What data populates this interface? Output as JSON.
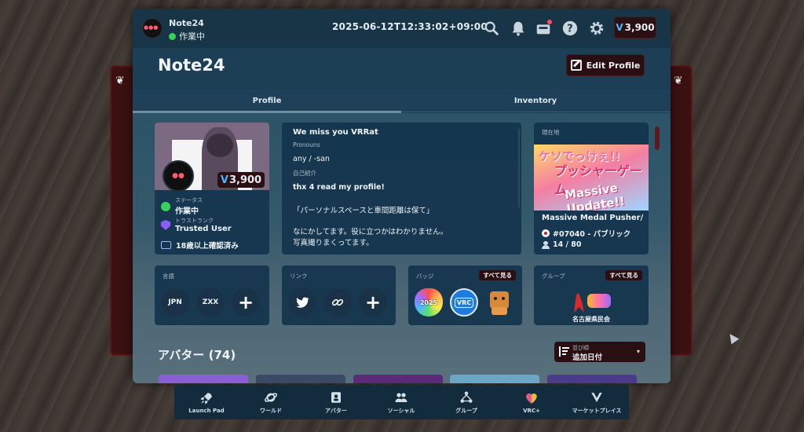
{
  "header": {
    "user_name": "Note24",
    "status": "作業中",
    "timestamp": "2025-06-12T12:33:02+09:00",
    "currency_symbol": "V",
    "currency_amount": "3,900",
    "icons": [
      "search-icon",
      "bell-icon",
      "mailbox-icon",
      "help-icon",
      "gear-icon"
    ]
  },
  "page": {
    "title": "Note24",
    "edit_profile": "Edit Profile"
  },
  "tabs": [
    {
      "label": "Profile",
      "active": true
    },
    {
      "label": "Inventory",
      "active": false
    }
  ],
  "profile_card": {
    "balance": "3,900",
    "status_label": "ステータス",
    "status_value": "作業中",
    "trust_label": "トラストランク",
    "trust_value": "Trusted User",
    "age_verified": "18歳以上確認済み"
  },
  "bio": {
    "title": "We miss you VRRat",
    "pronouns_label": "Pronouns",
    "pronouns": "any / -san",
    "intro_label": "自己紹介",
    "lines": [
      "thx 4 read my profile!",
      "「パーソナルスペースと車間距離は保て」",
      "なにかしてます。役に立つかはわかりません。",
      "写真撮りまくってます。"
    ]
  },
  "location": {
    "label": "現在地",
    "world_name": "Massive Medal Pusher/...",
    "instance": "#07040 - パブリック",
    "occupancy": "14 / 80",
    "image_texts": [
      "ケソでっけぇ!!",
      "プッシャーゲーム",
      "Massive Update!!"
    ]
  },
  "languages": {
    "label": "言語",
    "items": [
      "JPN",
      "ZXX"
    ]
  },
  "links": {
    "label": "リンク"
  },
  "badges": {
    "label": "バッジ",
    "see_all": "すべて見る",
    "items": [
      "2025",
      "VRC"
    ]
  },
  "groups": {
    "label": "グループ",
    "see_all": "すべて見る",
    "group_name": "名古屋県民会"
  },
  "avatars": {
    "title": "アバター (74)",
    "sort_label": "並び順",
    "sort_value": "追加日付"
  },
  "dock": [
    {
      "label": "Launch Pad",
      "icon": "rocket-icon"
    },
    {
      "label": "ワールド",
      "icon": "planet-icon"
    },
    {
      "label": "アバター",
      "icon": "avatar-icon"
    },
    {
      "label": "ソーシャル",
      "icon": "people-icon"
    },
    {
      "label": "グループ",
      "icon": "group-icon"
    },
    {
      "label": "VRC+",
      "icon": "vrcplus-icon"
    },
    {
      "label": "マーケットプレイス",
      "icon": "marketplace-icon"
    }
  ],
  "colors": {
    "accent_blue": "#49b8ff",
    "status_green": "#3ad15a",
    "dark_red_button": "#2a0f12",
    "panel": "#14344d"
  }
}
